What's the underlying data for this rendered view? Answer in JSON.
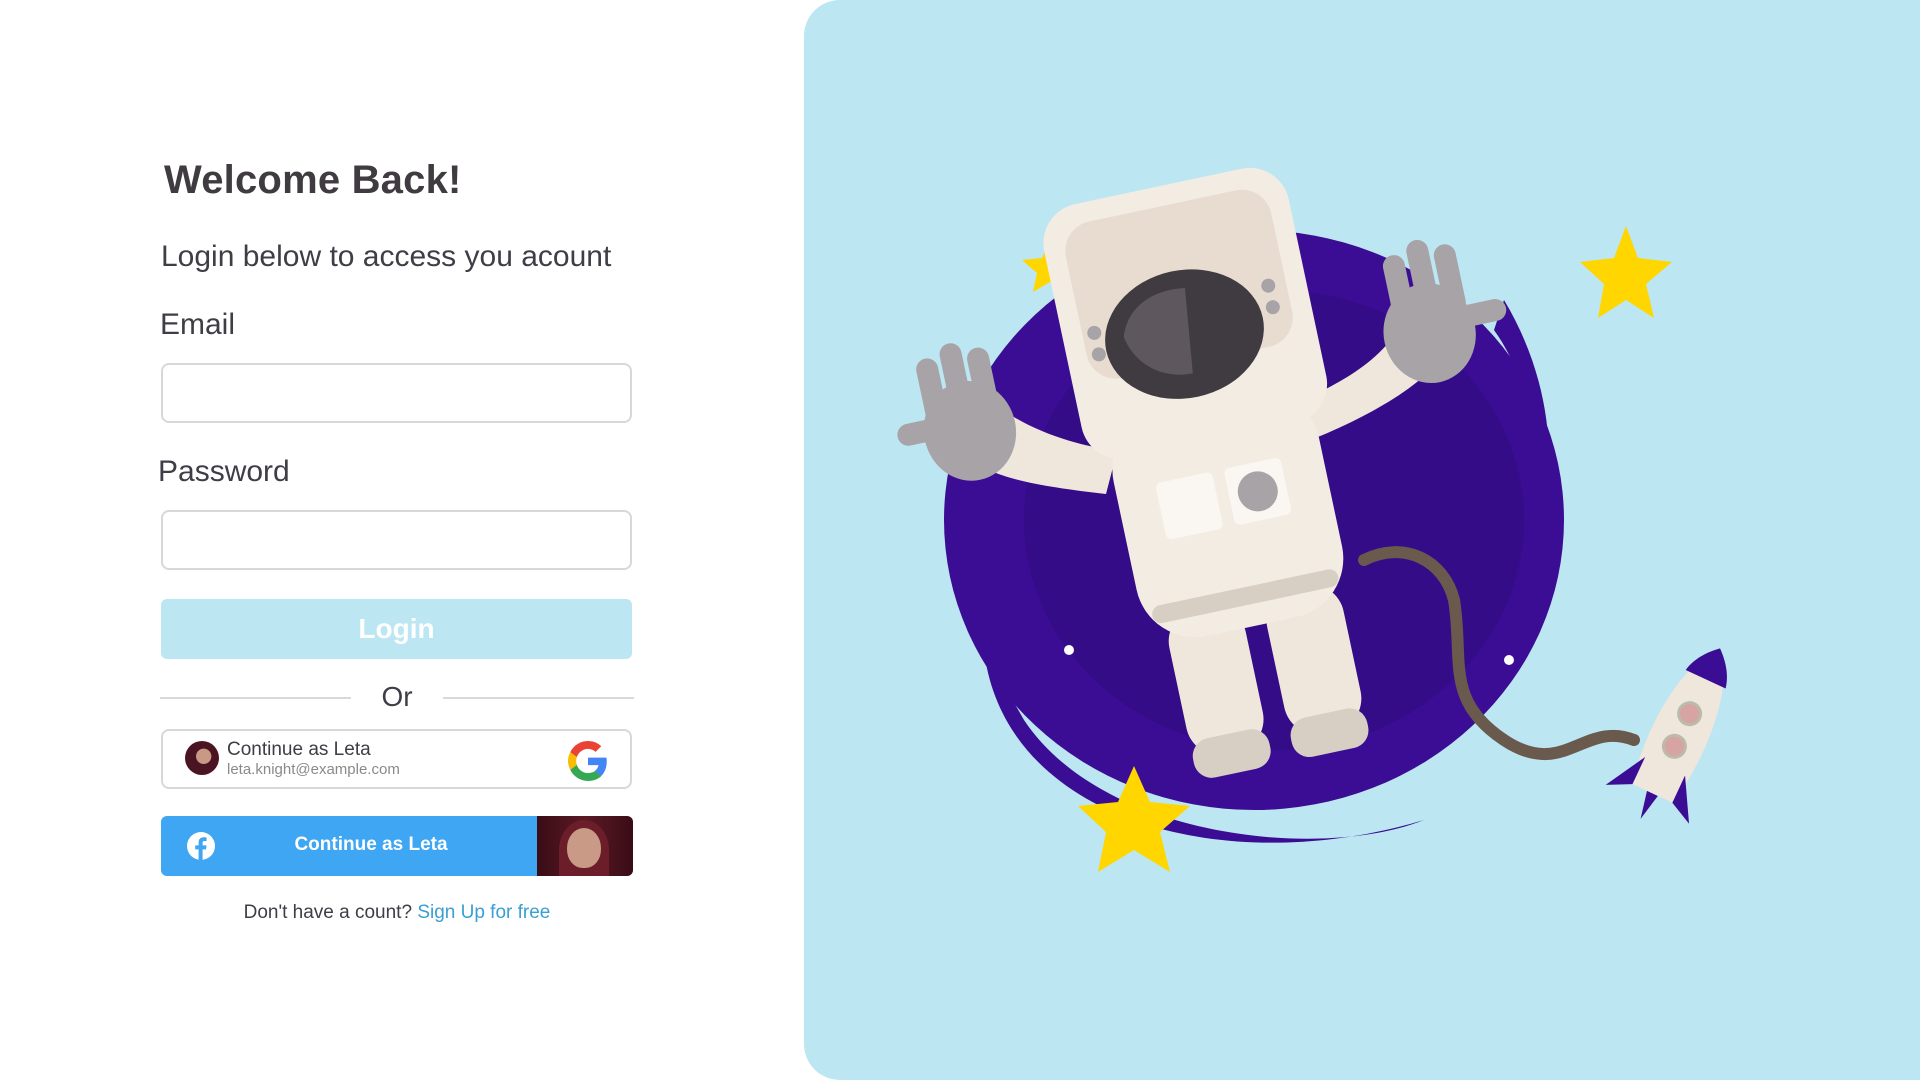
{
  "login": {
    "title": "Welcome Back!",
    "subtitle": "Login below to access you acount",
    "email_label": "Email",
    "email_value": "",
    "password_label": "Password",
    "password_value": "",
    "login_button": "Login",
    "divider_text": "Or"
  },
  "google": {
    "name": "Continue as Leta",
    "email": "leta.knight@example.com",
    "icon": "google-icon"
  },
  "facebook": {
    "label": "Continue as Leta",
    "icon": "facebook-icon"
  },
  "signup": {
    "prompt": "Don't have a count?",
    "link": "Sign Up for free"
  },
  "colors": {
    "accent_light": "#bde6f3",
    "facebook_blue": "#3ea6f2",
    "link": "#3a9fd3",
    "galaxy": "#3b0d94",
    "star": "#ffd600"
  },
  "illustration": {
    "subject": "astronaut-floating-illustration"
  }
}
